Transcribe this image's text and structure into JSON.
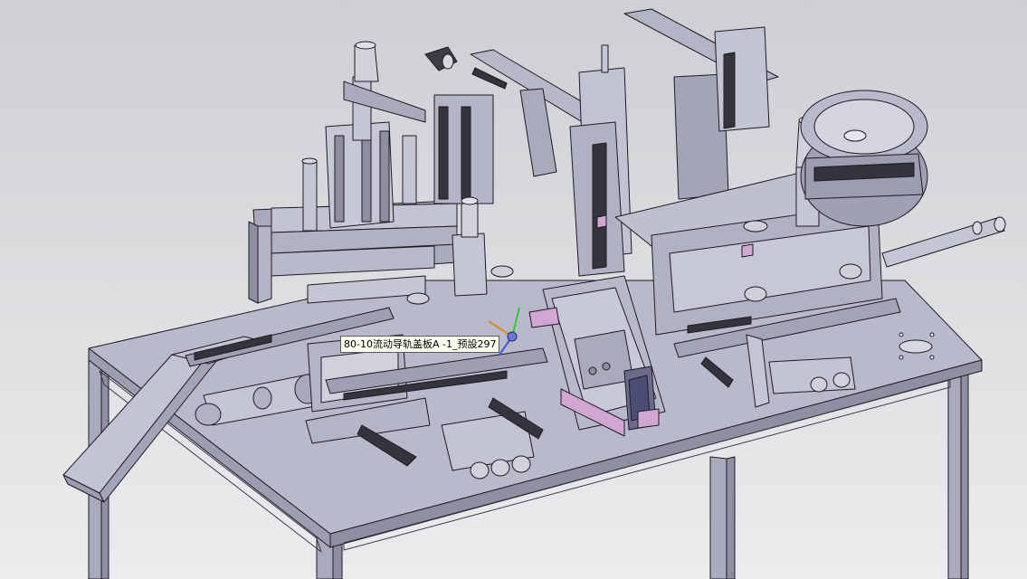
{
  "viewport": {
    "background_top": "#cfcfd3",
    "background_bottom": "#ececee",
    "part_fill": "#b7b8c9",
    "part_dark": "#8e8fa3",
    "edge": "#1c1c22",
    "highlight": "#d2a6d2"
  },
  "model_tree_hover": {
    "tooltip_text": "80-10流动导轨盖板A -1_预設297"
  },
  "triad": {
    "x_color": "#d9892e",
    "y_color": "#3cc43c",
    "z_color": "#3b5bd6"
  }
}
